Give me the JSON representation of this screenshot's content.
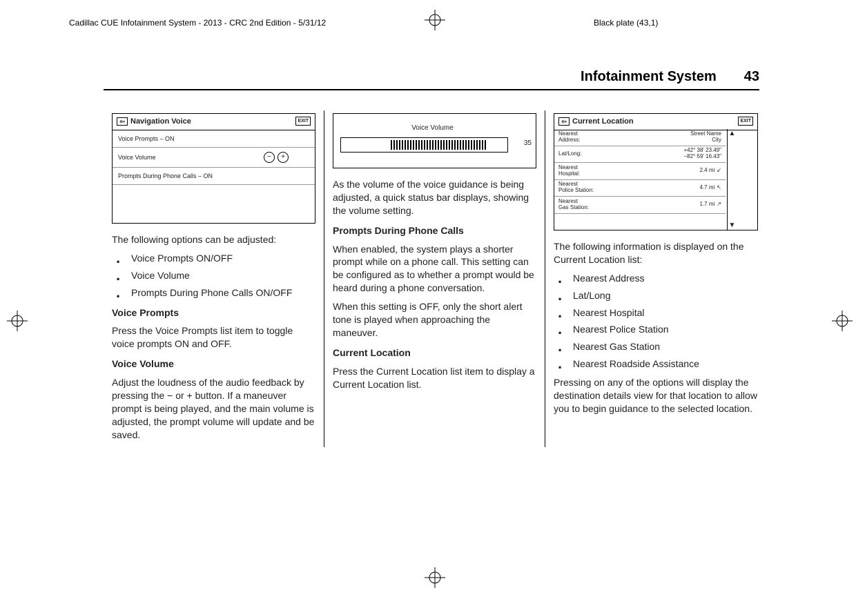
{
  "meta": {
    "header_left": "Cadillac CUE Infotainment System - 2013 - CRC 2nd Edition - 5/31/12",
    "header_plate": "Black plate (43,1)"
  },
  "page": {
    "section_title": "Infotainment System",
    "page_number": "43"
  },
  "fig_nav": {
    "title": "Navigation Voice",
    "exit": "EXIT",
    "row1": "Voice Prompts – ON",
    "row2": "Voice Volume",
    "minus": "−",
    "plus": "+",
    "row3": "Prompts During Phone Calls – ON"
  },
  "fig_vol": {
    "label": "Voice Volume",
    "value": "35"
  },
  "fig_loc": {
    "title": "Current Location",
    "exit": "EXIT",
    "rows": {
      "r1l": "Nearest\nAddress:",
      "r1r": "Street Name\nCity",
      "r2l": "Lat/Long:",
      "r2r": "+42° 38' 23.49\"\n−82° 59' 16.43\"",
      "r3l": "Nearest\nHospital:",
      "r3r": "2.4 mi",
      "r4l": "Nearest\nPolice Station:",
      "r4r": "4.7 mi",
      "r5l": "Nearest\nGas Station:",
      "r5r": "1.7 mi"
    }
  },
  "col1": {
    "p1": "The following options can be adjusted:",
    "li1": "Voice Prompts ON/OFF",
    "li2": "Voice Volume",
    "li3": "Prompts During Phone Calls ON/OFF",
    "sh1": "Voice Prompts",
    "p2": "Press the Voice Prompts list item to toggle voice prompts ON and OFF.",
    "sh2": "Voice Volume",
    "p3": "Adjust the loudness of the audio feedback by pressing the − or + button. If a maneuver prompt is being played, and the main volume is adjusted, the prompt volume will update and be saved."
  },
  "col2": {
    "p1": "As the volume of the voice guidance is being adjusted, a quick status bar displays, showing the volume setting.",
    "sh1": "Prompts During Phone Calls",
    "p2": "When enabled, the system plays a shorter prompt while on a phone call. This setting can be configured as to whether a prompt would be heard during a phone conversation.",
    "p3": "When this setting is OFF, only the short alert tone is played when approaching the maneuver.",
    "sh2": "Current Location",
    "p4": "Press the Current Location list item to display a Current Location list."
  },
  "col3": {
    "p1": "The following information is displayed on the Current Location list:",
    "li1": "Nearest Address",
    "li2": "Lat/Long",
    "li3": "Nearest Hospital",
    "li4": "Nearest Police Station",
    "li5": "Nearest Gas Station",
    "li6": "Nearest Roadside Assistance",
    "p2": "Pressing on any of the options will display the destination details view for that location to allow you to begin guidance to the selected location."
  }
}
